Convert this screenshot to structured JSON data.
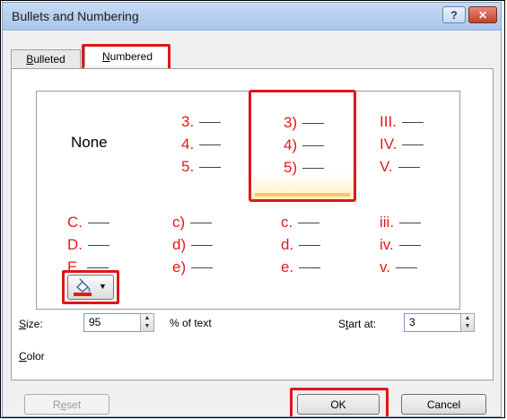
{
  "dialog": {
    "title": "Bullets and Numbering",
    "help_icon": "?",
    "close_icon": "✕"
  },
  "tabs": [
    {
      "label_prefix": "",
      "label_accel": "B",
      "label_rest": "ulleted",
      "active": false
    },
    {
      "label_prefix": "",
      "label_accel": "N",
      "label_rest": "umbered",
      "active": true
    }
  ],
  "styles": {
    "none_label": "None",
    "cells": [
      [
        "3.",
        "4.",
        "5."
      ],
      [
        "3)",
        "4)",
        "5)"
      ],
      [
        "III.",
        "IV.",
        "V."
      ],
      [
        "C.",
        "D.",
        "E."
      ],
      [
        "c)",
        "d)",
        "e)"
      ],
      [
        "c.",
        "d.",
        "e."
      ],
      [
        "iii.",
        "iv.",
        "v."
      ]
    ],
    "selected_index": 1
  },
  "size": {
    "label_accel": "S",
    "label_rest": "ize:",
    "value": "95",
    "suffix": "% of text"
  },
  "start_at": {
    "label_prefix": "S",
    "label_accel": "t",
    "label_rest": "art at:",
    "value": "3"
  },
  "color": {
    "label_accel": "C",
    "label_rest": "olor",
    "swatch": "#e31a1a",
    "icon": "paint-bucket-icon"
  },
  "buttons": {
    "reset_prefix": "R",
    "reset_accel": "e",
    "reset_rest": "set",
    "ok": "OK",
    "cancel": "Cancel"
  },
  "colors": {
    "accent_red": "#e0161a",
    "numbering_text": "#e31a1a"
  }
}
